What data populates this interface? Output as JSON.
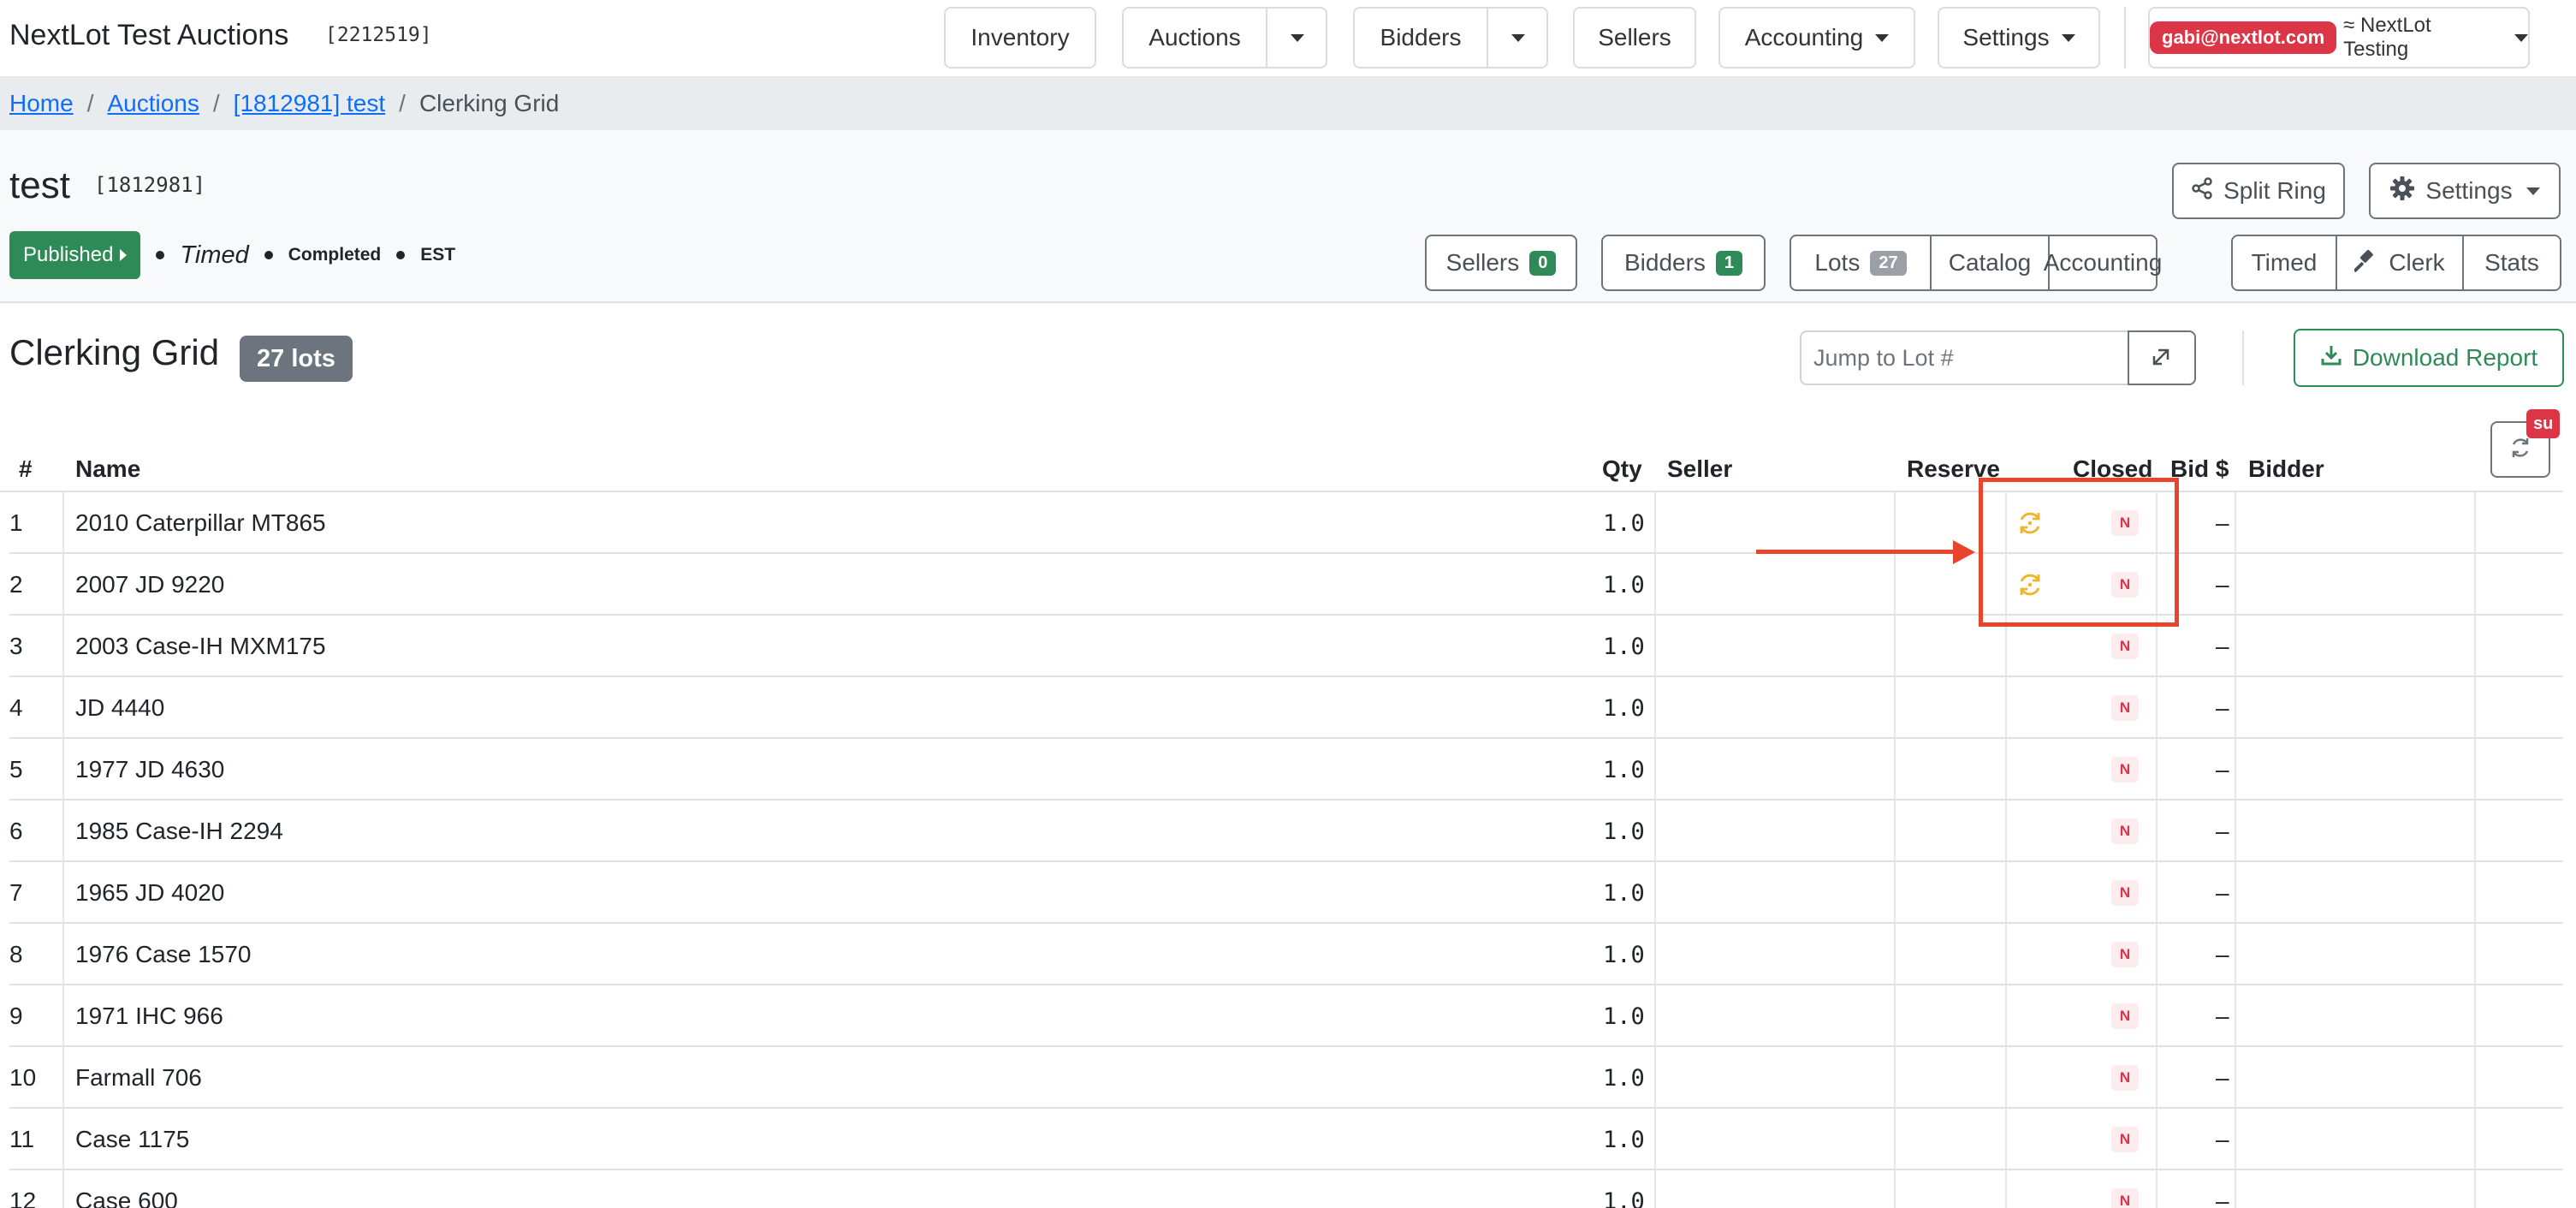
{
  "navbar": {
    "brand": "NextLot Test Auctions",
    "brand_id": "[2212519]",
    "inventory": "Inventory",
    "auctions": "Auctions",
    "bidders": "Bidders",
    "sellers": "Sellers",
    "accounting": "Accounting",
    "settings": "Settings",
    "user_email": "gabi@nextlot.com",
    "org": "≈ NextLot Testing"
  },
  "breadcrumb": {
    "home": "Home",
    "auctions": "Auctions",
    "auction": "[1812981] test",
    "current": "Clerking Grid"
  },
  "auction": {
    "title": "test",
    "id": "[1812981]",
    "status_published": "Published",
    "status_timed": "Timed",
    "status_completed": "Completed",
    "timezone": "EST",
    "split_ring": "Split Ring",
    "settings": "Settings",
    "sellers_label": "Sellers",
    "sellers_count": "0",
    "bidders_label": "Bidders",
    "bidders_count": "1",
    "lots_label": "Lots",
    "lots_count": "27",
    "catalog": "Catalog",
    "accounting": "Accounting",
    "timed": "Timed",
    "clerk": "Clerk",
    "stats": "Stats"
  },
  "grid": {
    "title": "Clerking Grid",
    "lots_badge": "27 lots",
    "jump_placeholder": "Jump to Lot #",
    "download": "Download Report",
    "su_badge": "su",
    "columns": {
      "num": "#",
      "name": "Name",
      "qty": "Qty",
      "seller": "Seller",
      "reserve": "Reserve",
      "closed": "Closed",
      "bid": "Bid $",
      "bidder": "Bidder"
    },
    "rows": [
      {
        "num": "1",
        "name": "2010 Caterpillar MT865",
        "qty": "1.0",
        "closed": "N",
        "bid": "–",
        "syncing": true
      },
      {
        "num": "2",
        "name": "2007 JD 9220",
        "qty": "1.0",
        "closed": "N",
        "bid": "–",
        "syncing": true
      },
      {
        "num": "3",
        "name": "2003 Case-IH MXM175",
        "qty": "1.0",
        "closed": "N",
        "bid": "–",
        "syncing": false
      },
      {
        "num": "4",
        "name": "JD 4440",
        "qty": "1.0",
        "closed": "N",
        "bid": "–",
        "syncing": false
      },
      {
        "num": "5",
        "name": "1977 JD 4630",
        "qty": "1.0",
        "closed": "N",
        "bid": "–",
        "syncing": false
      },
      {
        "num": "6",
        "name": "1985 Case-IH 2294",
        "qty": "1.0",
        "closed": "N",
        "bid": "–",
        "syncing": false
      },
      {
        "num": "7",
        "name": "1965 JD 4020",
        "qty": "1.0",
        "closed": "N",
        "bid": "–",
        "syncing": false
      },
      {
        "num": "8",
        "name": "1976 Case 1570",
        "qty": "1.0",
        "closed": "N",
        "bid": "–",
        "syncing": false
      },
      {
        "num": "9",
        "name": "1971 IHC 966",
        "qty": "1.0",
        "closed": "N",
        "bid": "–",
        "syncing": false
      },
      {
        "num": "10",
        "name": "Farmall 706",
        "qty": "1.0",
        "closed": "N",
        "bid": "–",
        "syncing": false
      },
      {
        "num": "11",
        "name": "Case 1175",
        "qty": "1.0",
        "closed": "N",
        "bid": "–",
        "syncing": false
      },
      {
        "num": "12",
        "name": "Case 600",
        "qty": "1.0",
        "closed": "N",
        "bid": "–",
        "syncing": false
      }
    ]
  },
  "colors": {
    "accent_green": "#2e8b57",
    "danger_red": "#dc3545",
    "sync_yellow": "#f0b429",
    "annotation_red": "#e8452c"
  }
}
